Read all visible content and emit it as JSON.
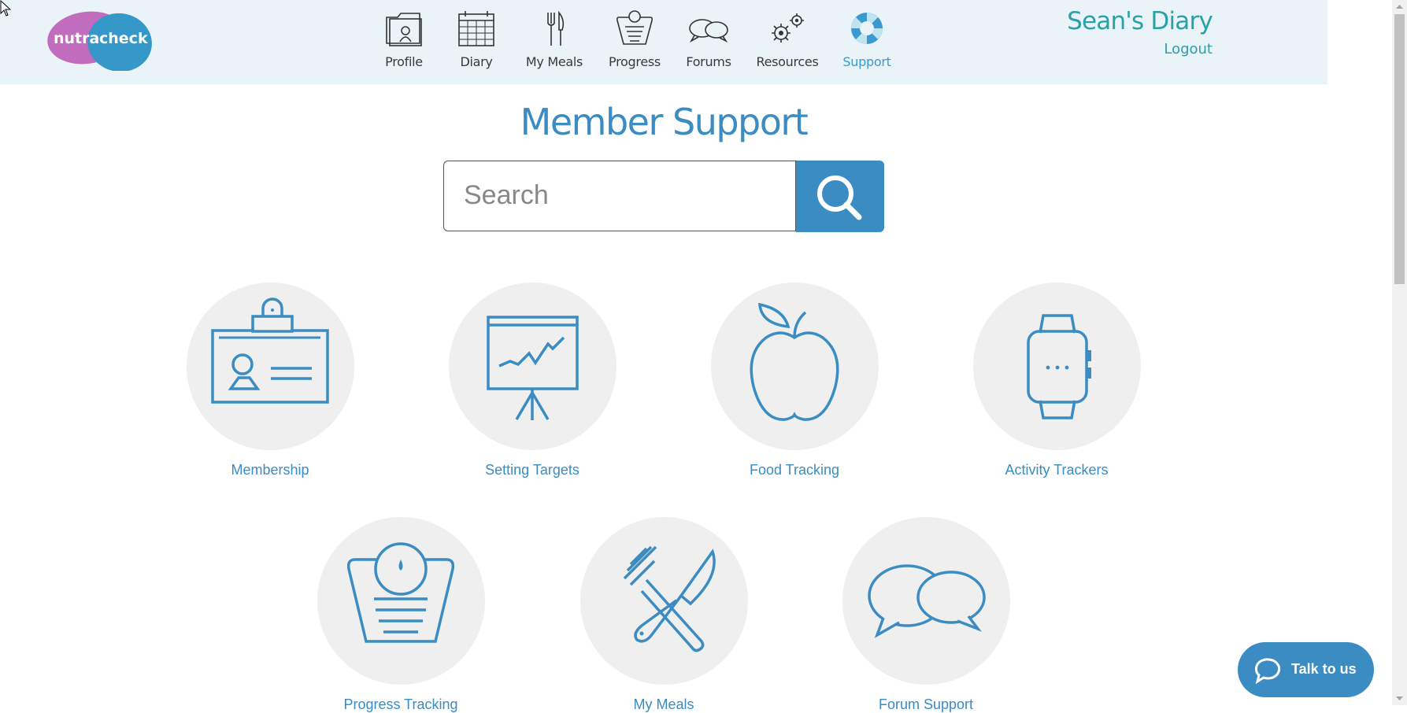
{
  "header": {
    "logo": {
      "word_left": "nutra",
      "word_right": "check",
      "color_left": "#c16cbd",
      "color_right": "#3598c8"
    },
    "nav": [
      {
        "label": "Profile",
        "icon": "profile-folder-icon"
      },
      {
        "label": "Diary",
        "icon": "calendar-icon"
      },
      {
        "label": "My Meals",
        "icon": "fork-knife-icon"
      },
      {
        "label": "Progress",
        "icon": "scales-icon"
      },
      {
        "label": "Forums",
        "icon": "speech-bubbles-icon"
      },
      {
        "label": "Resources",
        "icon": "gears-icon"
      },
      {
        "label": "Support",
        "icon": "lifebuoy-icon",
        "active": true
      }
    ],
    "user_title": "Sean's Diary",
    "logout": "Logout"
  },
  "main": {
    "title": "Member Support",
    "search": {
      "placeholder": "Search",
      "value": ""
    },
    "tiles": [
      {
        "label": "Membership",
        "icon": "id-card-icon"
      },
      {
        "label": "Setting Targets",
        "icon": "presentation-chart-icon"
      },
      {
        "label": "Food Tracking",
        "icon": "apple-icon"
      },
      {
        "label": "Activity Trackers",
        "icon": "smartwatch-icon"
      },
      {
        "label": "Progress Tracking",
        "icon": "scales-icon"
      },
      {
        "label": "My Meals",
        "icon": "fork-knife-icon"
      },
      {
        "label": "Forum Support",
        "icon": "speech-bubbles-icon"
      }
    ]
  },
  "chat_widget": {
    "label": "Talk to us",
    "icon": "chat-bubble-icon"
  },
  "colors": {
    "accent": "#3a8cc2",
    "teal": "#2aa0a7",
    "header_bg": "#e9f3f8",
    "tile_bg": "#efefef"
  }
}
